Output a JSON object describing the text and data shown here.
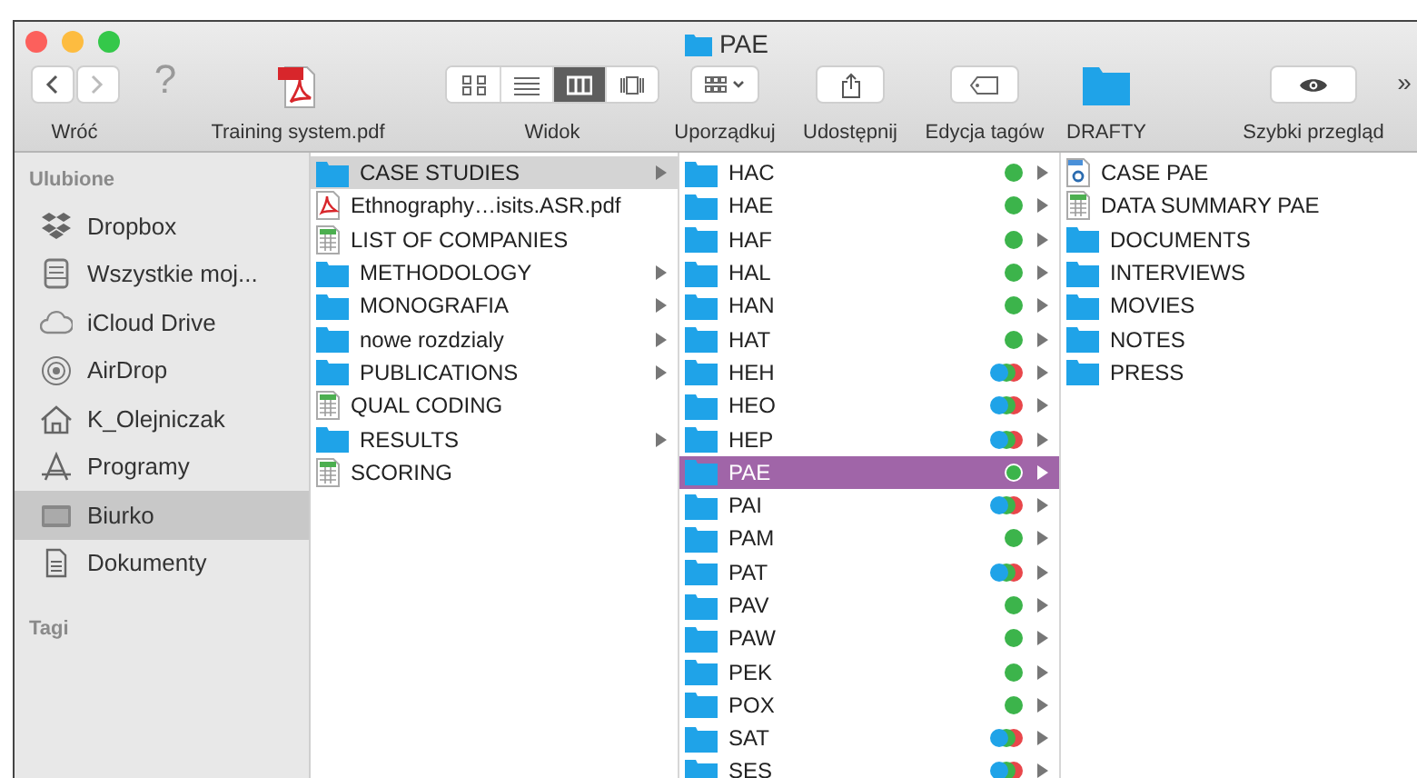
{
  "window": {
    "title": "PAE"
  },
  "toolbar": {
    "items": [
      {
        "kind": "nav",
        "label": "Wróć"
      },
      {
        "kind": "help",
        "text": "?"
      },
      {
        "kind": "file",
        "label": "Training system.pdf"
      },
      {
        "kind": "view",
        "label": "Widok",
        "modes": [
          {
            "selected": false
          },
          {
            "selected": false
          },
          {
            "selected": true
          },
          {
            "selected": false
          }
        ]
      },
      {
        "kind": "arrange",
        "label": "Uporządkuj"
      },
      {
        "kind": "share",
        "label": "Udostępnij"
      },
      {
        "kind": "tag",
        "label": "Edycja tagów"
      },
      {
        "kind": "folder",
        "label": "DRAFTY"
      },
      {
        "kind": "quicklook",
        "label": "Szybki przegląd"
      },
      {
        "kind": "more",
        "text": "»"
      }
    ]
  },
  "sidebar": {
    "sections": [
      {
        "title": "Ulubione",
        "items": [
          {
            "kind": "dropbox",
            "label": "Dropbox",
            "selected": false
          },
          {
            "kind": "allfiles",
            "label": "Wszystkie moj...",
            "selected": false
          },
          {
            "kind": "cloud",
            "label": "iCloud Drive",
            "selected": false
          },
          {
            "kind": "airdrop",
            "label": "AirDrop",
            "selected": false
          },
          {
            "kind": "home",
            "label": "K_Olejniczak",
            "selected": false
          },
          {
            "kind": "apps",
            "label": "Programy",
            "selected": false
          },
          {
            "kind": "desktop",
            "label": "Biurko",
            "selected": true
          },
          {
            "kind": "docs",
            "label": "Dokumenty",
            "selected": false
          }
        ]
      },
      {
        "title": "Tagi"
      }
    ]
  },
  "columns": [
    {
      "items": [
        {
          "kind": "folder",
          "name": "CASE STUDIES",
          "expandable": true,
          "selected": true
        },
        {
          "kind": "pdf",
          "name": "Ethnography…isits.ASR.pdf",
          "expandable": false,
          "selected": false
        },
        {
          "kind": "sheet",
          "name": "LIST OF COMPANIES",
          "expandable": false,
          "selected": false
        },
        {
          "kind": "folder",
          "name": "METHODOLOGY",
          "expandable": true,
          "selected": false
        },
        {
          "kind": "folder",
          "name": "MONOGRAFIA",
          "expandable": true,
          "selected": false
        },
        {
          "kind": "folder",
          "name": "nowe rozdzialy",
          "expandable": true,
          "selected": false
        },
        {
          "kind": "folder",
          "name": "PUBLICATIONS",
          "expandable": true,
          "selected": false
        },
        {
          "kind": "sheet",
          "name": "QUAL CODING",
          "expandable": false,
          "selected": false
        },
        {
          "kind": "folder",
          "name": "RESULTS",
          "expandable": true,
          "selected": false
        },
        {
          "kind": "sheet",
          "name": "SCORING",
          "expandable": false,
          "selected": false
        }
      ]
    },
    {
      "items": [
        {
          "kind": "folder",
          "name": "HAC",
          "expandable": true,
          "selected": false,
          "tags": [
            {
              "color": "#3cb44b"
            }
          ]
        },
        {
          "kind": "folder",
          "name": "HAE",
          "expandable": true,
          "selected": false,
          "tags": [
            {
              "color": "#3cb44b"
            }
          ]
        },
        {
          "kind": "folder",
          "name": "HAF",
          "expandable": true,
          "selected": false,
          "tags": [
            {
              "color": "#3cb44b"
            }
          ]
        },
        {
          "kind": "folder",
          "name": "HAL",
          "expandable": true,
          "selected": false,
          "tags": [
            {
              "color": "#3cb44b"
            }
          ]
        },
        {
          "kind": "folder",
          "name": "HAN",
          "expandable": true,
          "selected": false,
          "tags": [
            {
              "color": "#3cb44b"
            }
          ]
        },
        {
          "kind": "folder",
          "name": "HAT",
          "expandable": true,
          "selected": false,
          "tags": [
            {
              "color": "#3cb44b"
            }
          ]
        },
        {
          "kind": "folder",
          "name": "HEH",
          "expandable": true,
          "selected": false,
          "tags": [
            {
              "color": "#1fa3e8"
            },
            {
              "color": "#3cb44b"
            },
            {
              "color": "#e8464a"
            }
          ]
        },
        {
          "kind": "folder",
          "name": "HEO",
          "expandable": true,
          "selected": false,
          "tags": [
            {
              "color": "#1fa3e8"
            },
            {
              "color": "#3cb44b"
            },
            {
              "color": "#e8464a"
            }
          ]
        },
        {
          "kind": "folder",
          "name": "HEP",
          "expandable": true,
          "selected": false,
          "tags": [
            {
              "color": "#1fa3e8"
            },
            {
              "color": "#3cb44b"
            },
            {
              "color": "#e8464a"
            }
          ]
        },
        {
          "kind": "folder",
          "name": "PAE",
          "expandable": true,
          "selected": true,
          "tags": [
            {
              "color": "#3cb44b"
            }
          ]
        },
        {
          "kind": "folder",
          "name": "PAI",
          "expandable": true,
          "selected": false,
          "tags": [
            {
              "color": "#1fa3e8"
            },
            {
              "color": "#3cb44b"
            },
            {
              "color": "#e8464a"
            }
          ]
        },
        {
          "kind": "folder",
          "name": "PAM",
          "expandable": true,
          "selected": false,
          "tags": [
            {
              "color": "#3cb44b"
            }
          ]
        },
        {
          "kind": "folder",
          "name": "PAT",
          "expandable": true,
          "selected": false,
          "tags": [
            {
              "color": "#1fa3e8"
            },
            {
              "color": "#3cb44b"
            },
            {
              "color": "#e8464a"
            }
          ]
        },
        {
          "kind": "folder",
          "name": "PAV",
          "expandable": true,
          "selected": false,
          "tags": [
            {
              "color": "#3cb44b"
            }
          ]
        },
        {
          "kind": "folder",
          "name": "PAW",
          "expandable": true,
          "selected": false,
          "tags": [
            {
              "color": "#3cb44b"
            }
          ]
        },
        {
          "kind": "folder",
          "name": "PEK",
          "expandable": true,
          "selected": false,
          "tags": [
            {
              "color": "#3cb44b"
            }
          ]
        },
        {
          "kind": "folder",
          "name": "POX",
          "expandable": true,
          "selected": false,
          "tags": [
            {
              "color": "#3cb44b"
            }
          ]
        },
        {
          "kind": "folder",
          "name": "SAT",
          "expandable": true,
          "selected": false,
          "tags": [
            {
              "color": "#1fa3e8"
            },
            {
              "color": "#3cb44b"
            },
            {
              "color": "#e8464a"
            }
          ]
        },
        {
          "kind": "folder",
          "name": "SES",
          "expandable": true,
          "selected": false,
          "tags": [
            {
              "color": "#1fa3e8"
            },
            {
              "color": "#3cb44b"
            },
            {
              "color": "#e8464a"
            }
          ]
        }
      ]
    },
    {
      "items": [
        {
          "kind": "doc",
          "name": "CASE PAE",
          "expandable": false,
          "selected": false
        },
        {
          "kind": "sheet",
          "name": "DATA SUMMARY PAE",
          "expandable": false,
          "selected": false
        },
        {
          "kind": "folder",
          "name": "DOCUMENTS",
          "expandable": false,
          "selected": false
        },
        {
          "kind": "folder",
          "name": "INTERVIEWS",
          "expandable": false,
          "selected": false
        },
        {
          "kind": "folder",
          "name": "MOVIES",
          "expandable": false,
          "selected": false
        },
        {
          "kind": "folder",
          "name": "NOTES",
          "expandable": false,
          "selected": false
        },
        {
          "kind": "folder",
          "name": "PRESS",
          "expandable": false,
          "selected": false
        }
      ]
    }
  ]
}
